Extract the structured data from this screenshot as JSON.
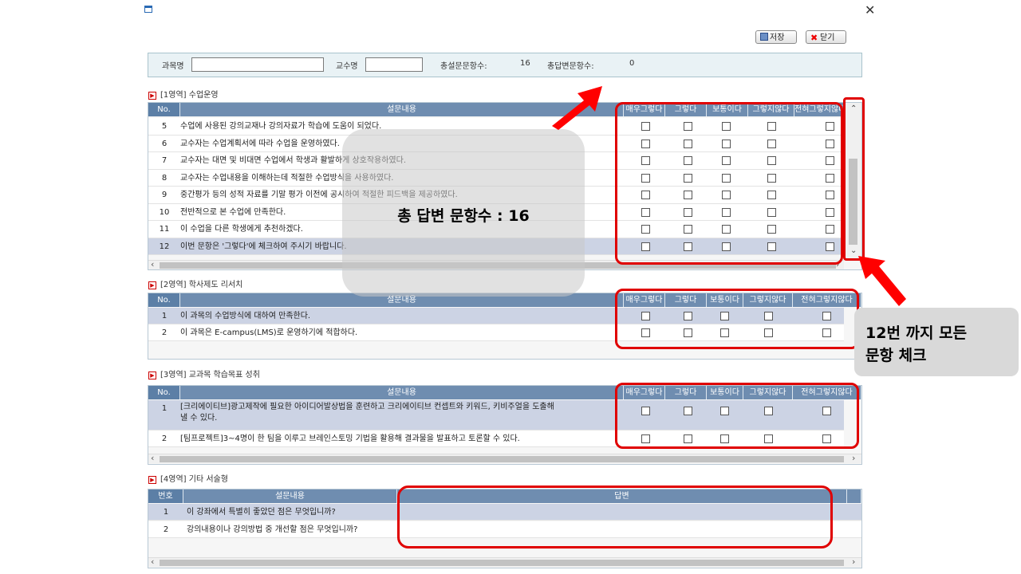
{
  "toolbar": {
    "save_label": "저장",
    "close_label": "닫기"
  },
  "info": {
    "course_label": "과목명",
    "professor_label": "교수명",
    "total_questions_label": "총설문문항수:",
    "total_questions_value": "16",
    "total_answered_label": "총답변문항수:",
    "total_answered_value": "0"
  },
  "columns": {
    "no": "No.",
    "content": "설문내용",
    "options": [
      "매우그렇다",
      "그렇다",
      "보통이다",
      "그렇지않다",
      "전혀그렇지않다"
    ],
    "num_ko": "번호",
    "answer": "답변"
  },
  "sections": [
    {
      "title": "[1영역] 수업운영",
      "rows": [
        {
          "no": "5",
          "text": "수업에 사용된 강의교재나 강의자료가 학습에 도움이 되었다."
        },
        {
          "no": "6",
          "text": "교수자는 수업계획서에 따라 수업을 운영하였다."
        },
        {
          "no": "7",
          "text": "교수자는 대면  및 비대면 수업에서 학생과 활발하게 상호작용하였다."
        },
        {
          "no": "8",
          "text": "교수자는 수업내용을 이해하는데 적절한 수업방식을 사용하였다."
        },
        {
          "no": "9",
          "text": "중간평가 등의 성적 자료를 기말 평가 이전에 공시하여 적절한 피드백을 제공하였다."
        },
        {
          "no": "10",
          "text": "전반적으로 본 수업에 만족한다."
        },
        {
          "no": "11",
          "text": "이 수업을 다른 학생에게 추천하겠다."
        },
        {
          "no": "12",
          "text": "이번 문항은 '그렇다'에 체크하여 주시기 바랍니다."
        }
      ]
    },
    {
      "title": "[2영역] 학사제도 리서치",
      "rows": [
        {
          "no": "1",
          "text": "이 과목의 수업방식에 대하여 만족한다."
        },
        {
          "no": "2",
          "text": "이 과목은 E-campus(LMS)로 운영하기에 적합하다."
        }
      ]
    },
    {
      "title": "[3영역] 교과목 학습목표 성취",
      "rows": [
        {
          "no": "1",
          "text": "[크리에이티브]광고제작에 필요한 아이디어발상법을 훈련하고 크리에이티브 컨셉트와 키워드, 키비주얼을 도출해",
          "text2": "낼 수 있다."
        },
        {
          "no": "2",
          "text": "[팀프로젝트]3~4명이 한 팀을 이루고 브레인스토밍 기법을 활용해 결과물을 발표하고 토론할 수 있다."
        }
      ]
    },
    {
      "title": "[4영역] 기타 서술형",
      "rows": [
        {
          "no": "1",
          "text": "이 강좌에서 특별히 좋았던 점은 무엇입니까?"
        },
        {
          "no": "2",
          "text": "강의내용이나 강의방법 중 개선할 점은 무엇입니까?"
        }
      ]
    }
  ],
  "annotations": {
    "center_text": "총 답변 문항수 : 16",
    "side_text_line1": "12번 까지 모든",
    "side_text_line2": "문항 체크"
  },
  "colors": {
    "header": "#6f8db0",
    "selected_row": "#ccd3e4",
    "annotation_red": "#e00000"
  }
}
